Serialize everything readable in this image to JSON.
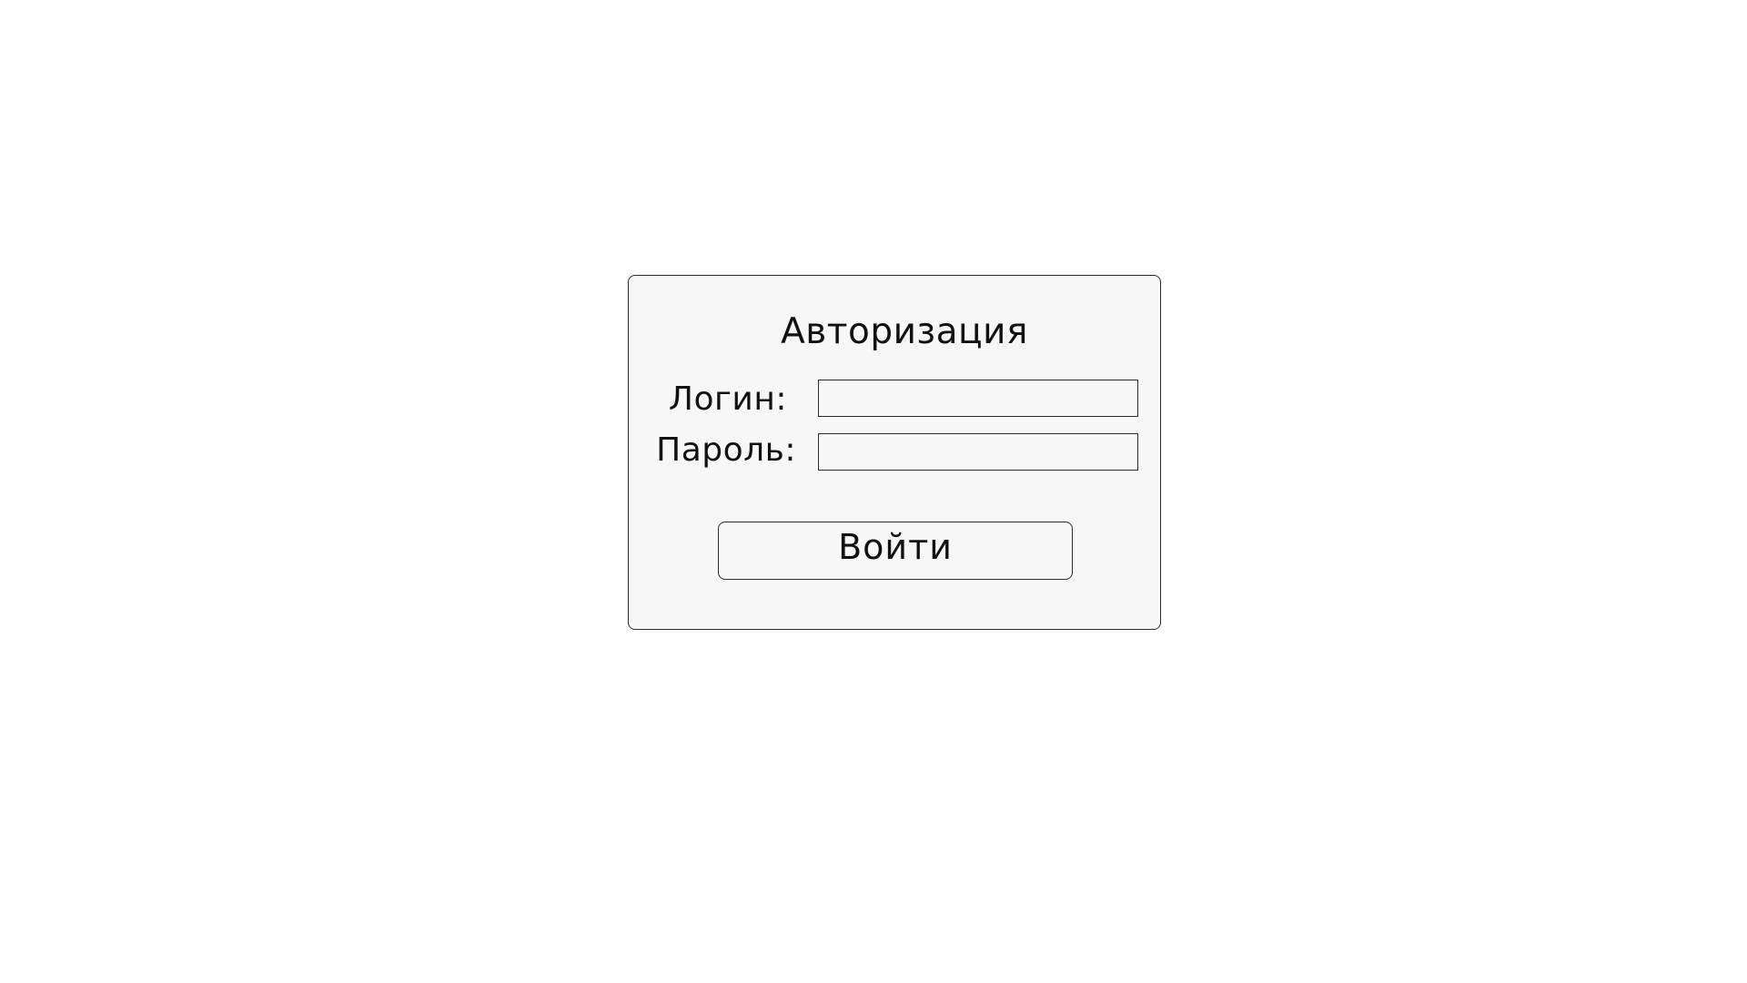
{
  "login_form": {
    "title": "Авторизация",
    "login_label": "Логин:",
    "login_value": "",
    "password_label": "Пароль:",
    "password_value": "",
    "submit_label": "Войти"
  }
}
